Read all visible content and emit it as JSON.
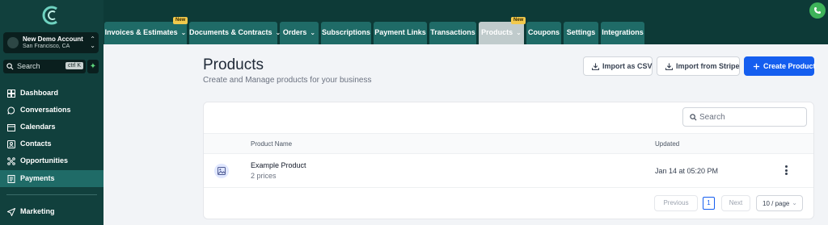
{
  "account": {
    "name": "New Demo Account",
    "location": "San Francisco, CA"
  },
  "sidebar_search": {
    "placeholder": "Search",
    "shortcut": "ctrl K"
  },
  "sidebar": {
    "items": [
      {
        "label": "Dashboard",
        "icon": "dashboard-icon"
      },
      {
        "label": "Conversations",
        "icon": "chat-icon"
      },
      {
        "label": "Calendars",
        "icon": "calendar-icon"
      },
      {
        "label": "Contacts",
        "icon": "contacts-icon"
      },
      {
        "label": "Opportunities",
        "icon": "opportunities-icon"
      },
      {
        "label": "Payments",
        "icon": "payments-icon",
        "active": true
      },
      {
        "label": "Marketing",
        "icon": "send-icon"
      }
    ]
  },
  "tabs": [
    {
      "label": "Invoices & Estimates",
      "dropdown": true,
      "badge": "New"
    },
    {
      "label": "Documents & Contracts",
      "dropdown": true
    },
    {
      "label": "Orders",
      "dropdown": true
    },
    {
      "label": "Subscriptions"
    },
    {
      "label": "Payment Links"
    },
    {
      "label": "Transactions"
    },
    {
      "label": "Products",
      "dropdown": true,
      "badge": "New",
      "active": true
    },
    {
      "label": "Coupons"
    },
    {
      "label": "Settings"
    },
    {
      "label": "Integrations"
    }
  ],
  "header": {
    "title": "Products",
    "subtitle": "Create and Manage products for your business",
    "import_csv": "Import as CSV",
    "import_stripe": "Import from Stripe",
    "create": "Create Product"
  },
  "table": {
    "search_placeholder": "Search",
    "columns": [
      "Product Name",
      "Updated"
    ],
    "rows": [
      {
        "name": "Example Product",
        "prices": "2 prices",
        "updated": "Jan 14 at 05:20 PM"
      }
    ]
  },
  "pagination": {
    "previous": "Previous",
    "page": "1",
    "next": "Next",
    "page_size": "10 / page"
  },
  "colors": {
    "sidebar_bg": "#11403d",
    "tab_bg": "#1f6b67",
    "primary": "#155eef",
    "badge": "#f2c94c"
  }
}
